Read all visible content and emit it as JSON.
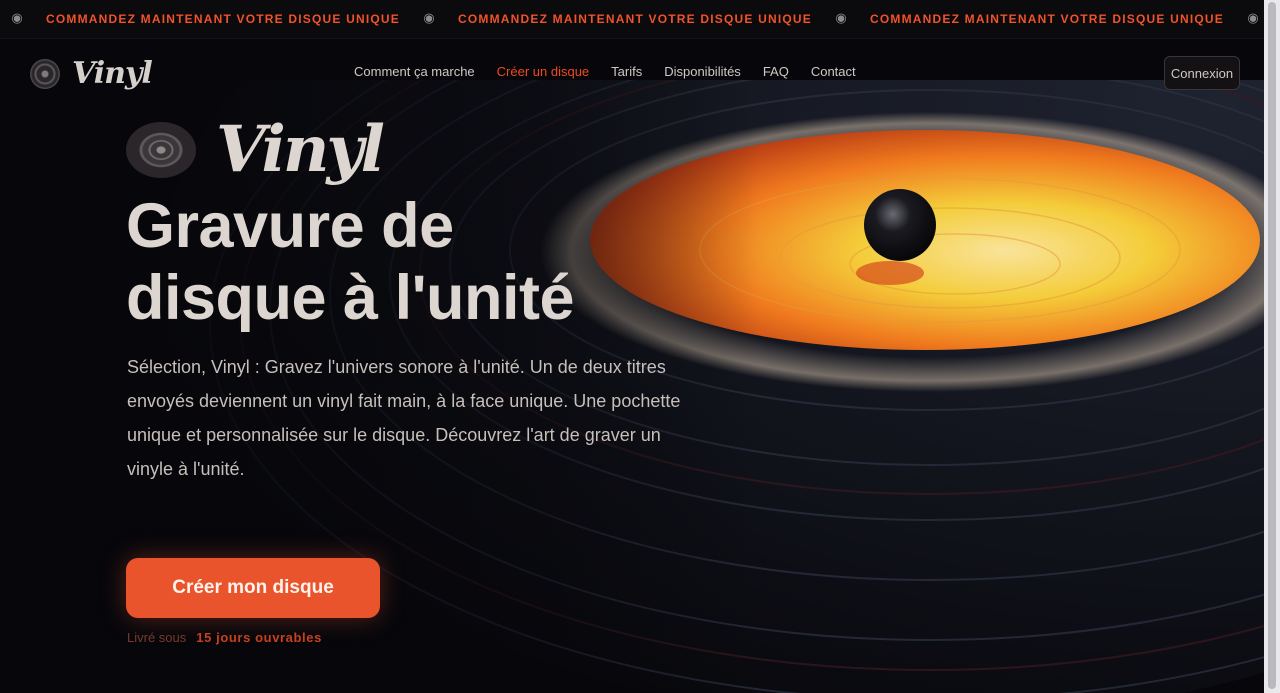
{
  "ticker": {
    "items": [
      "Commandez maintenant votre disque unique",
      "Commandez maintenant votre disque unique",
      "Commandez maintenant votre disque unique"
    ],
    "separator_icon": "vinyl-disc-icon"
  },
  "nav": {
    "brand": "Vinyl",
    "links": [
      {
        "label": "Comment ça marche",
        "active": false
      },
      {
        "label": "Créer un disque",
        "active": true
      },
      {
        "label": "Tarifs",
        "active": false
      },
      {
        "label": "Disponibilités",
        "active": false
      },
      {
        "label": "FAQ",
        "active": false
      },
      {
        "label": "Contact",
        "active": false
      }
    ],
    "login_label": "Connexion"
  },
  "hero": {
    "logo_word": "Vinyl",
    "title_line1": "Gravure de",
    "title_line2": "disque à l'unité",
    "description": "Sélection, Vinyl : Gravez l'univers sonore à l'unité. Un de deux titres envoyés deviennent un vinyl fait main, à la face unique. Une pochette unique et personnalisée sur le disque. Découvrez l'art de graver un vinyle à l'unité.",
    "cta_label": "Créer mon disque",
    "cta_sub_muted": "Livré sous",
    "cta_sub_accent": "15 jours ouvrables"
  },
  "colors": {
    "accent": "#e9542c",
    "background": "#07070b",
    "label_orange": "#f07a1e",
    "label_yellow": "#f4cd3a"
  }
}
